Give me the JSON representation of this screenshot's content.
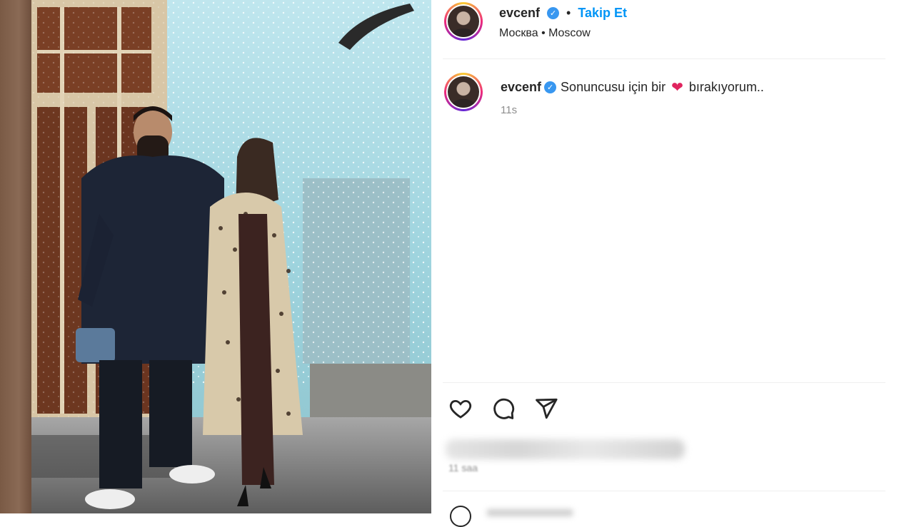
{
  "post": {
    "username": "evcenf",
    "separator": "•",
    "follow_label": "Takip Et",
    "location": "Москва • Moscow",
    "caption_username": "evcenf",
    "caption_text_start": "Sonuncusu için bir",
    "caption_emoji": "❤",
    "caption_text_end": "bırakıyorum..",
    "caption_time": "11s",
    "likes_text_blurred": "",
    "post_time_blurred": "11 saa"
  },
  "icons": {
    "like": "heart-icon",
    "comment": "comment-icon",
    "share": "send-icon",
    "verified": "verified-badge-icon"
  },
  "colors": {
    "follow_blue": "#0095f6",
    "verified_blue": "#3897f0",
    "heart_red": "#e0245e"
  }
}
